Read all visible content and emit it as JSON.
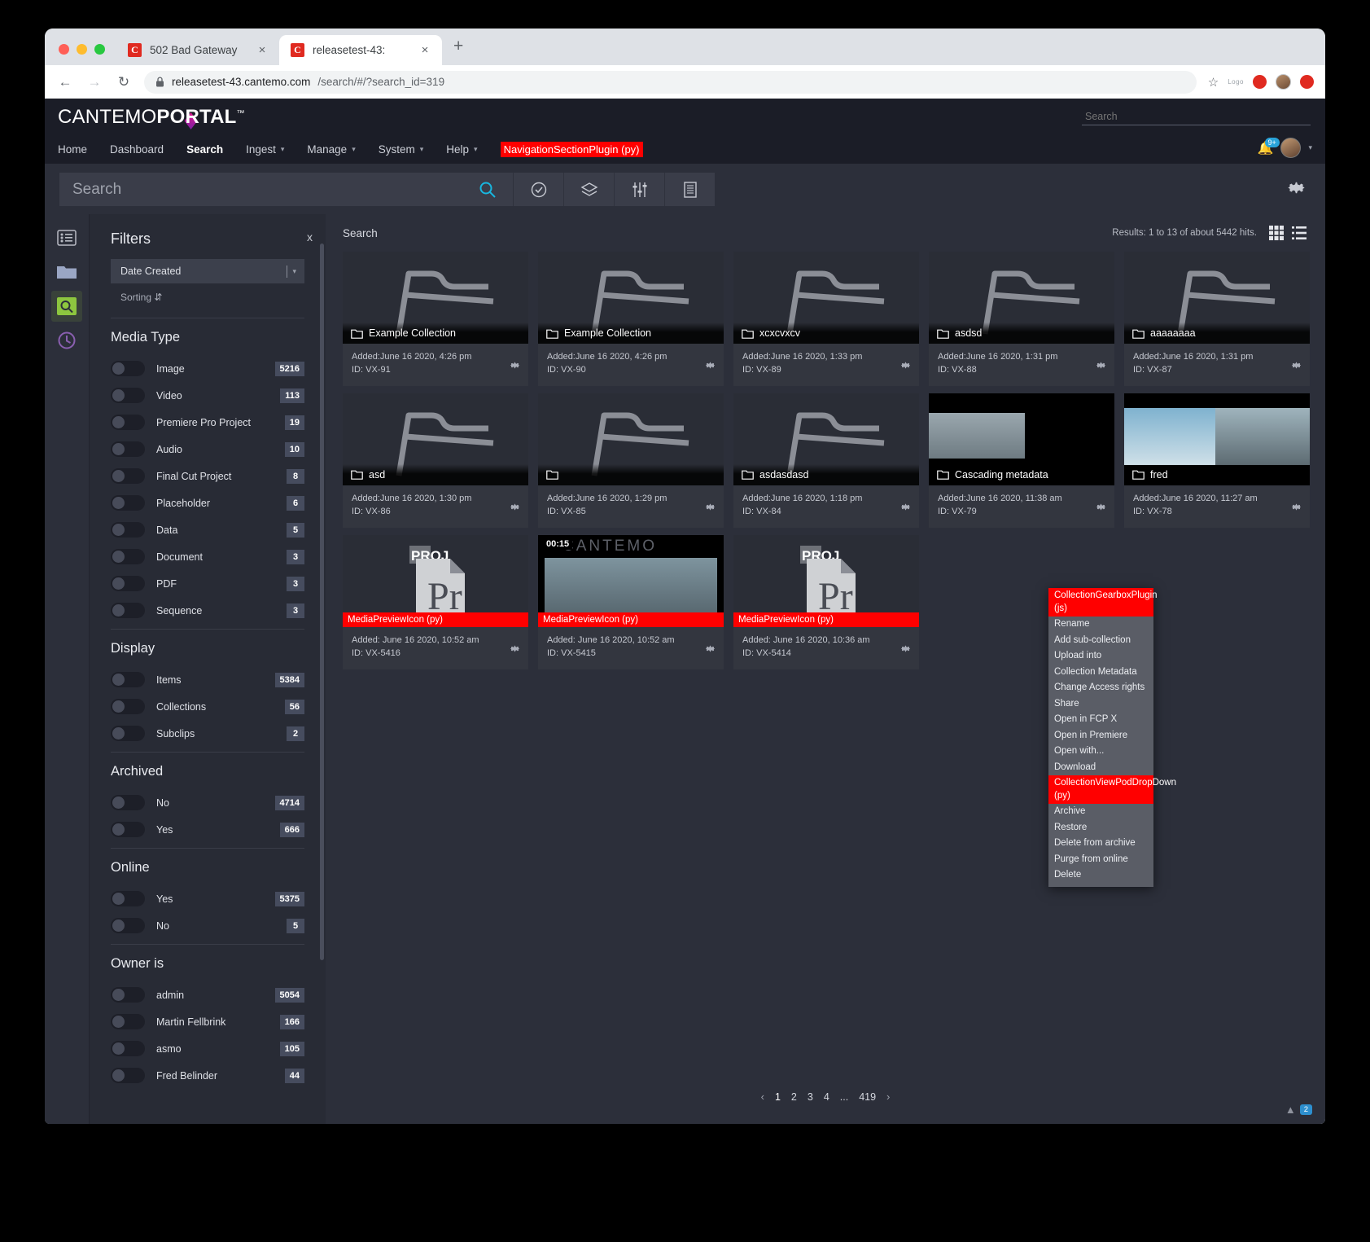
{
  "browser": {
    "tabs": [
      {
        "title": "502 Bad Gateway",
        "favicon": "C",
        "active": false
      },
      {
        "title": "releasetest-43:",
        "favicon": "C",
        "active": true
      }
    ],
    "newtab_label": "+",
    "close_label": "×",
    "back_icon": "←",
    "forward_icon": "→",
    "reload_icon": "↻",
    "lock_icon": "🔒",
    "url_host": "releasetest-43.cantemo.com",
    "url_path": "/search/#/?search_id=319",
    "star_icon": "☆",
    "ext_label": "Logo"
  },
  "header": {
    "logo_prefix": "CANTEMO",
    "logo_bold": "PORTAL",
    "logo_tm": "™",
    "top_search_placeholder": "Search",
    "notification_badge": "9+"
  },
  "nav": {
    "items": [
      {
        "label": "Home",
        "caret": false,
        "active": false
      },
      {
        "label": "Dashboard",
        "caret": false,
        "active": false
      },
      {
        "label": "Search",
        "caret": false,
        "active": true
      },
      {
        "label": "Ingest",
        "caret": true,
        "active": false
      },
      {
        "label": "Manage",
        "caret": true,
        "active": false
      },
      {
        "label": "System",
        "caret": true,
        "active": false
      },
      {
        "label": "Help",
        "caret": true,
        "active": false
      }
    ],
    "plugin_label": "NavigationSectionPlugin (py)",
    "plugin_color": "#ff0000"
  },
  "search_bar": {
    "placeholder": "Search",
    "icons": [
      "search-icon",
      "check-circle-icon",
      "layers-icon",
      "sliders-icon",
      "list-icon"
    ],
    "settings_icon": "gear-icon"
  },
  "rail": {
    "items": [
      "metadata-list-icon",
      "folder-icon",
      "saved-search-icon",
      "history-icon"
    ],
    "selected_index": 2
  },
  "filters": {
    "title": "Filters",
    "close_label": "x",
    "sort_field": "Date Created",
    "sorting_label": "Sorting",
    "groups": [
      {
        "title": "Media Type",
        "rows": [
          {
            "label": "Image",
            "count": "5216"
          },
          {
            "label": "Video",
            "count": "113"
          },
          {
            "label": "Premiere Pro Project",
            "count": "19"
          },
          {
            "label": "Audio",
            "count": "10"
          },
          {
            "label": "Final Cut Project",
            "count": "8"
          },
          {
            "label": "Placeholder",
            "count": "6"
          },
          {
            "label": "Data",
            "count": "5"
          },
          {
            "label": "Document",
            "count": "3"
          },
          {
            "label": "PDF",
            "count": "3"
          },
          {
            "label": "Sequence",
            "count": "3"
          }
        ]
      },
      {
        "title": "Display",
        "rows": [
          {
            "label": "Items",
            "count": "5384"
          },
          {
            "label": "Collections",
            "count": "56"
          },
          {
            "label": "Subclips",
            "count": "2"
          }
        ]
      },
      {
        "title": "Archived",
        "rows": [
          {
            "label": "No",
            "count": "4714"
          },
          {
            "label": "Yes",
            "count": "666"
          }
        ]
      },
      {
        "title": "Online",
        "rows": [
          {
            "label": "Yes",
            "count": "5375"
          },
          {
            "label": "No",
            "count": "5"
          }
        ]
      },
      {
        "title": "Owner is",
        "rows": [
          {
            "label": "admin",
            "count": "5054"
          },
          {
            "label": "Martin Fellbrink",
            "count": "166"
          },
          {
            "label": "asmo",
            "count": "105"
          },
          {
            "label": "Fred Belinder",
            "count": "44"
          }
        ]
      }
    ]
  },
  "results": {
    "title": "Search",
    "count_text": "Results: 1 to 13 of about 5442 hits.",
    "grid_view_icon": "grid-icon",
    "list_view_icon": "list-icon",
    "cards": [
      {
        "name": "Example Collection",
        "added": "Added:June 16 2020, 4:26 pm",
        "id": "ID: VX-91",
        "kind": "folder"
      },
      {
        "name": "Example Collection",
        "added": "Added:June 16 2020, 4:26 pm",
        "id": "ID: VX-90",
        "kind": "folder"
      },
      {
        "name": "xcxcvxcv",
        "added": "Added:June 16 2020, 1:33 pm",
        "id": "ID: VX-89",
        "kind": "folder"
      },
      {
        "name": "asdsd",
        "added": "Added:June 16 2020, 1:31 pm",
        "id": "ID: VX-88",
        "kind": "folder"
      },
      {
        "name": "aaaaaaaa",
        "added": "Added:June 16 2020, 1:31 pm",
        "id": "ID: VX-87",
        "kind": "folder"
      },
      {
        "name": "asd",
        "added": "Added:June 16 2020, 1:30 pm",
        "id": "ID: VX-86",
        "kind": "folder"
      },
      {
        "name": "",
        "added": "Added:June 16 2020, 1:29 pm",
        "id": "ID: VX-85",
        "kind": "folder"
      },
      {
        "name": "asdasdasd",
        "added": "Added:June 16 2020, 1:18 pm",
        "id": "ID: VX-84",
        "kind": "folder"
      },
      {
        "name": "Cascading metadata",
        "added": "Added:June 16 2020, 11:38 am",
        "id": "ID: VX-79",
        "kind": "image"
      },
      {
        "name": "fred",
        "added": "Added:June 16 2020, 11:27 am",
        "id": "ID: VX-78",
        "kind": "image"
      },
      {
        "name": "MediaPreviewIcon (py)",
        "added": "Added: June 16 2020, 10:52 am",
        "id": "ID: VX-5416",
        "kind": "project",
        "plugin": true
      },
      {
        "name": "MediaPreviewIcon (py)",
        "added": "Added: June 16 2020, 10:52 am",
        "id": "ID: VX-5415",
        "kind": "video",
        "plugin": true,
        "timecode": "00:15",
        "watermark": "CANTEMO"
      },
      {
        "name": "MediaPreviewIcon (py)",
        "added": "Added: June 16 2020, 10:36 am",
        "id": "ID: VX-5414",
        "kind": "project",
        "plugin": true
      }
    ]
  },
  "context_menu": {
    "items": [
      {
        "label": "CollectionGearboxPlugin (js)",
        "plugin": true
      },
      {
        "label": "Rename",
        "plugin": false
      },
      {
        "label": "Add sub-collection",
        "plugin": false
      },
      {
        "label": "Upload into",
        "plugin": false
      },
      {
        "label": "Collection Metadata",
        "plugin": false
      },
      {
        "label": "Change Access rights",
        "plugin": false
      },
      {
        "label": "Share",
        "plugin": false
      },
      {
        "label": "Open in FCP X",
        "plugin": false
      },
      {
        "label": "Open in Premiere",
        "plugin": false
      },
      {
        "label": "Open with...",
        "plugin": false
      },
      {
        "label": "Download",
        "plugin": false
      },
      {
        "label": "CollectionViewPodDropDown (py)",
        "plugin": true
      },
      {
        "label": "Archive",
        "plugin": false
      },
      {
        "label": "Restore",
        "plugin": false
      },
      {
        "label": "Delete from archive",
        "plugin": false
      },
      {
        "label": "Purge from online",
        "plugin": false
      },
      {
        "label": "Delete",
        "plugin": false
      }
    ]
  },
  "pagination": {
    "prev_icon": "‹",
    "next_icon": "›",
    "pages": [
      "1",
      "2",
      "3",
      "4",
      "...",
      "419"
    ],
    "current": "1"
  },
  "corner": {
    "badge_count": "2",
    "arrow_icon": "▲"
  }
}
